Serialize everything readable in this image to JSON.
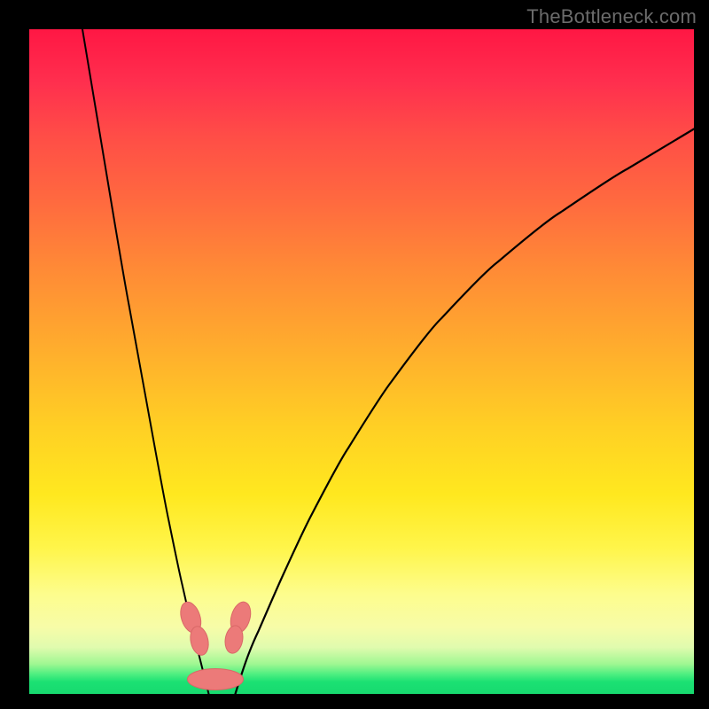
{
  "watermark": "TheBottleneck.com",
  "colors": {
    "background": "#000000",
    "gradient_top": "#ff1744",
    "gradient_bottom": "#17d96f",
    "curve": "#000000",
    "marker": "#ec7a79"
  },
  "chart_data": {
    "type": "line",
    "title": "",
    "xlabel": "",
    "ylabel": "",
    "xlim": [
      0,
      100
    ],
    "ylim": [
      0,
      100
    ],
    "series": [
      {
        "name": "left-curve",
        "x": [
          8,
          10,
          12,
          14,
          16,
          18,
          20,
          22,
          24,
          25,
          26,
          27
        ],
        "y": [
          100,
          88,
          76,
          64,
          53,
          42,
          31,
          21,
          12,
          8,
          4,
          0
        ]
      },
      {
        "name": "right-curve",
        "x": [
          31,
          33,
          36,
          40,
          45,
          51,
          58,
          66,
          75,
          85,
          95,
          100
        ],
        "y": [
          0,
          6,
          13,
          22,
          32,
          42,
          52,
          61,
          69,
          76,
          82,
          85
        ]
      }
    ],
    "markers": [
      {
        "name": "left-pill-upper",
        "cx": 24.3,
        "cy": 11.5,
        "rx": 1.4,
        "ry": 2.4,
        "angle": -18
      },
      {
        "name": "left-pill-lower",
        "cx": 25.6,
        "cy": 8.0,
        "rx": 1.3,
        "ry": 2.2,
        "angle": -12
      },
      {
        "name": "right-pill-upper",
        "cx": 31.8,
        "cy": 11.5,
        "rx": 1.4,
        "ry": 2.4,
        "angle": 16
      },
      {
        "name": "right-pill-lower",
        "cx": 30.8,
        "cy": 8.2,
        "rx": 1.3,
        "ry": 2.1,
        "angle": 10
      },
      {
        "name": "bottom-pill",
        "cx": 28.0,
        "cy": 2.2,
        "rx": 4.2,
        "ry": 1.6,
        "angle": 0
      }
    ]
  }
}
